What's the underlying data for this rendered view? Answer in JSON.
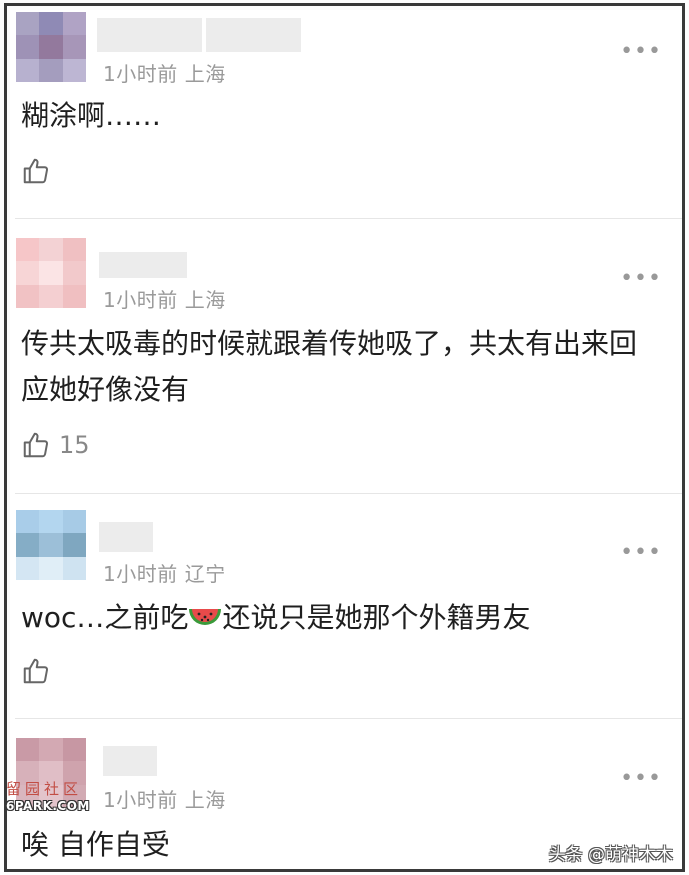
{
  "comments": [
    {
      "meta_time": "1小时前",
      "meta_location": "上海",
      "text": "糊涂啊……",
      "likes": "",
      "avatar_colors": [
        "#a9a3c2",
        "#8f8ab5",
        "#b0a3c5",
        "#9e92b6",
        "#93799d",
        "#a796b8",
        "#b7b1cf",
        "#a49dbe",
        "#bdb6d3"
      ]
    },
    {
      "meta_time": "1小时前",
      "meta_location": "上海",
      "text": "传共太吸毒的时候就跟着传她吸了，共太有出来回应她好像没有",
      "likes": "15",
      "avatar_colors": [
        "#f6c6c8",
        "#f3d2d4",
        "#f0c0c2",
        "#f7d5d6",
        "#fbe4e5",
        "#f2c9cb",
        "#f1c2c4",
        "#f4cfd1",
        "#f0bfc1"
      ]
    },
    {
      "meta_time": "1小时前",
      "meta_location": "辽宁",
      "text_before": "woc…之前吃",
      "text_after": "还说只是她那个外籍男友",
      "likes": "",
      "avatar_colors": [
        "#a9cde9",
        "#b3d6ef",
        "#a7cbe6",
        "#85adc6",
        "#9cbfd8",
        "#7fa7c0",
        "#d4e6f3",
        "#e0eef7",
        "#cfe3f1"
      ]
    },
    {
      "meta_time": "1小时前",
      "meta_location": "上海",
      "text": "唉 自作自受",
      "likes": "",
      "avatar_colors": [
        "#c99aa6",
        "#d3a9b3",
        "#c797a3",
        "#d7b1ba",
        "#e0bec6",
        "#cfa3ad",
        "#d9b6be",
        "#e3c4cb",
        "#d2aab3"
      ]
    }
  ],
  "more_label": "•••",
  "watermarks": {
    "left_cn": "留园社区",
    "left_en": "6PARK.COM",
    "right": "头条 @萌神木木"
  }
}
